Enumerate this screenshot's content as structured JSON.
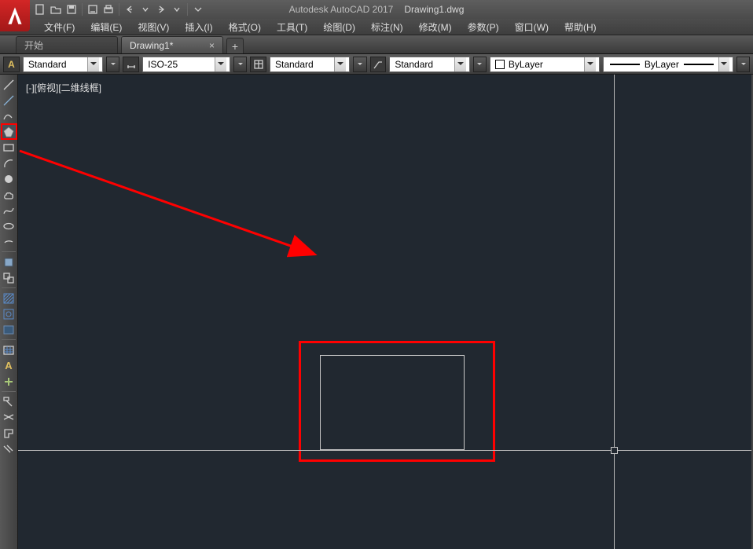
{
  "title": {
    "app": "Autodesk AutoCAD 2017",
    "doc": "Drawing1.dwg"
  },
  "menu": [
    "文件(F)",
    "编辑(E)",
    "视图(V)",
    "插入(I)",
    "格式(O)",
    "工具(T)",
    "绘图(D)",
    "标注(N)",
    "修改(M)",
    "参数(P)",
    "窗口(W)",
    "帮助(H)"
  ],
  "tabs": {
    "start": "开始",
    "doc": "Drawing1*",
    "add": "+"
  },
  "props": {
    "textStyle": "Standard",
    "dimStyle": "ISO-25",
    "tableStyle": "Standard",
    "mleaderStyle": "Standard",
    "layerColor": "ByLayer",
    "linetype": "ByLayer"
  },
  "viewport": {
    "label": "[-][俯视][二维线框]"
  },
  "tool_names": [
    "line",
    "xline",
    "arc",
    "polygon",
    "rect",
    "circle",
    "revcloud",
    "spline",
    "ellipse",
    "ellipse-arc",
    "insert",
    "block",
    "hatch",
    "gradient",
    "region",
    "table",
    "table2",
    "text",
    "attach",
    "point-style",
    "mtext",
    "mleader",
    "dim",
    "attach2"
  ]
}
